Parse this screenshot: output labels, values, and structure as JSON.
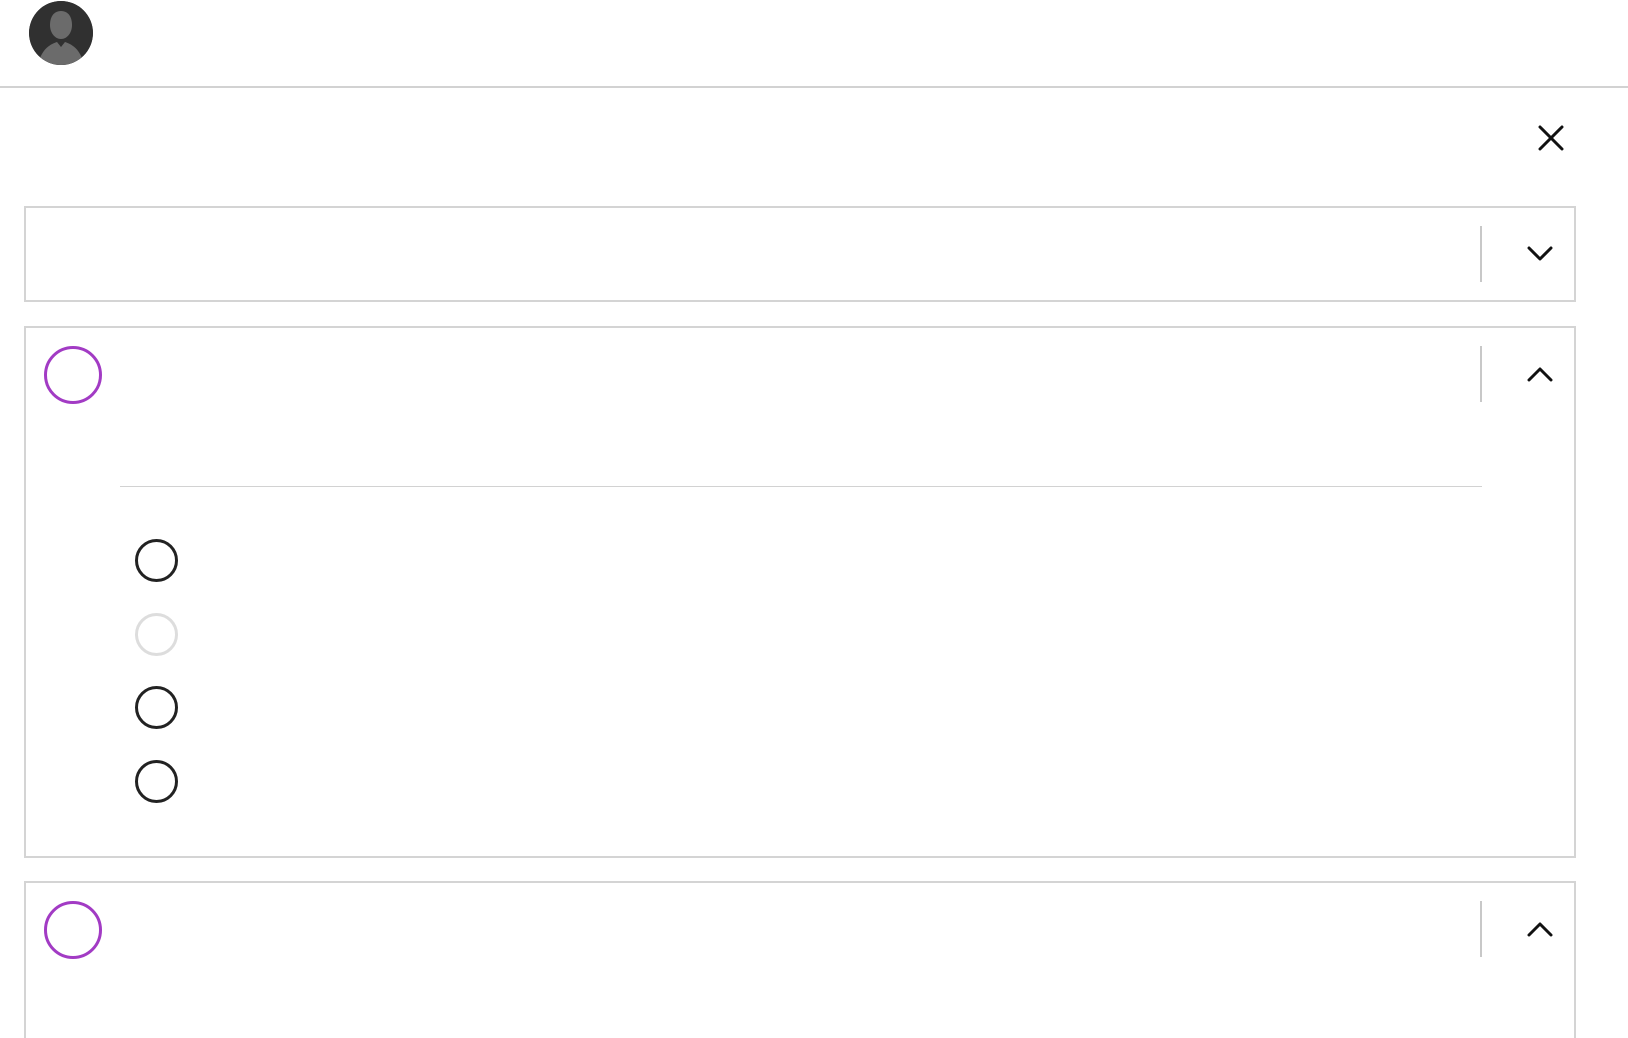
{
  "app": {
    "title": ""
  },
  "header": {
    "avatar_icon": "user-avatar-icon"
  },
  "dialog": {
    "close_icon": "close-icon"
  },
  "cards": [
    {
      "label": "",
      "toggle_icon": "chevron-down-icon",
      "expanded": false
    },
    {
      "label": "",
      "status_icon": "empty-circle-icon",
      "toggle_icon": "chevron-up-icon",
      "expanded": true,
      "options": [
        {
          "label": "",
          "disabled": false
        },
        {
          "label": "",
          "disabled": true
        },
        {
          "label": "",
          "disabled": false
        },
        {
          "label": "",
          "disabled": false
        }
      ]
    },
    {
      "label": "",
      "status_icon": "empty-circle-icon",
      "toggle_icon": "chevron-up-icon",
      "expanded": true
    }
  ],
  "colors": {
    "accent": "#a23bc4",
    "border": "#d4d4d4",
    "radio": "#222222",
    "radio_disabled": "#dddddd"
  }
}
